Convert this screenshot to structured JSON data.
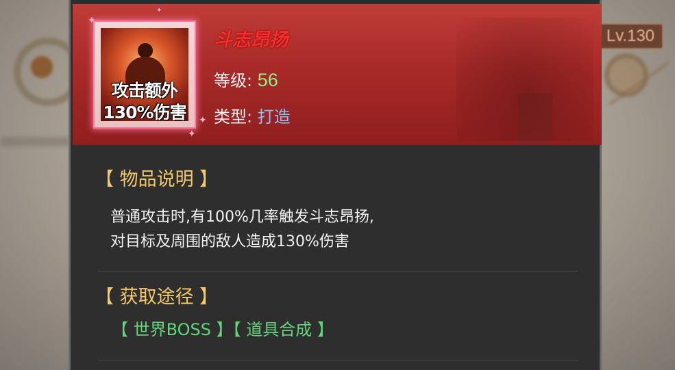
{
  "background": {
    "level_badge": "Lv.130"
  },
  "item": {
    "name": "斗志昂扬",
    "icon_text_line1": "攻击额外",
    "icon_text_line2": "130%伤害",
    "level_label": "等级:",
    "level_value": "56",
    "type_label": "类型:",
    "type_value": "打造"
  },
  "description": {
    "title": "【 物品说明 】",
    "line1": "普通攻击时,有100%几率触发斗志昂扬,",
    "line2": "对目标及周围的敌人造成130%伤害"
  },
  "obtain": {
    "title": "【 获取途径 】",
    "sources": "【 世界BOSS 】【 道具合成 】"
  },
  "colors": {
    "item_name": "#ff2a2a",
    "level_value": "#8ff08c",
    "type_value": "#7fc4ff",
    "section_title": "#f3c96a",
    "obtain_text": "#63d67a",
    "header_bg": "#a82a28"
  }
}
